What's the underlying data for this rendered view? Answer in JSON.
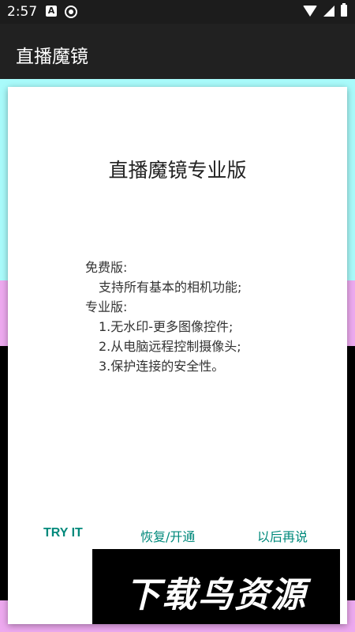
{
  "status_bar": {
    "time": "2:57",
    "icons": [
      "a-icon",
      "camera-icon",
      "wifi-icon",
      "signal-icon",
      "battery-icon"
    ],
    "a_label": "A"
  },
  "app_bar": {
    "title": "直播魔镜"
  },
  "colors": {
    "background_cyan": "#a9fbfb",
    "background_pink": "#eda9ef",
    "accent": "#00897b",
    "app_bar": "#212121"
  },
  "dialog": {
    "title": "直播魔镜专业版",
    "body_lines": [
      "免费版:",
      "支持所有基本的相机功能;",
      "专业版:",
      "1.无水印-更多图像控件;",
      "2.从电脑远程控制摄像头;",
      "3.保护连接的安全性。"
    ],
    "actions": {
      "try": "TRY IT",
      "restore": "恢复/开通",
      "later": "以后再说"
    }
  },
  "watermark": {
    "text": "下载鸟资源"
  }
}
